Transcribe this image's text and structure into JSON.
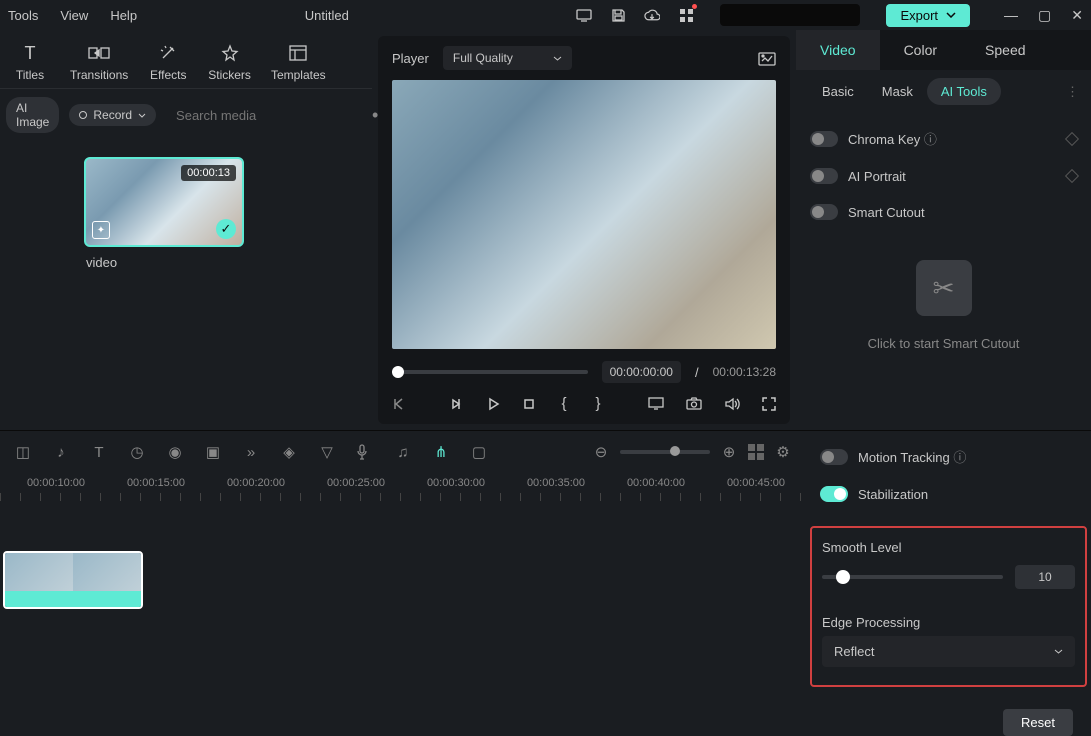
{
  "titlebar": {
    "menus": [
      "Tools",
      "View",
      "Help"
    ],
    "title": "Untitled",
    "export": "Export"
  },
  "toolTabs": [
    {
      "label": "Titles"
    },
    {
      "label": "Transitions"
    },
    {
      "label": "Effects"
    },
    {
      "label": "Stickers"
    },
    {
      "label": "Templates"
    }
  ],
  "filter": {
    "aiImage": "AI Image",
    "record": "Record",
    "searchPlaceholder": "Search media"
  },
  "media": {
    "duration": "00:00:13",
    "name": "video"
  },
  "preview": {
    "playerLabel": "Player",
    "quality": "Full Quality",
    "currentTime": "00:00:00:00",
    "sep": "/",
    "totalTime": "00:00:13:28"
  },
  "propTabs": [
    "Video",
    "Color",
    "Speed"
  ],
  "subTabs": [
    "Basic",
    "Mask",
    "AI Tools"
  ],
  "props": {
    "chroma": "Chroma Key",
    "aiPortrait": "AI Portrait",
    "smartCutout": "Smart Cutout",
    "cutoutHint": "Click to start Smart Cutout",
    "motionTracking": "Motion Tracking",
    "stabilization": "Stabilization",
    "smoothLevel": "Smooth Level",
    "smoothValue": "10",
    "edgeProcessing": "Edge Processing",
    "edgeValue": "Reflect",
    "reset": "Reset"
  },
  "ruler": [
    "00:00:10:00",
    "00:00:15:00",
    "00:00:20:00",
    "00:00:25:00",
    "00:00:30:00",
    "00:00:35:00",
    "00:00:40:00",
    "00:00:45:00"
  ]
}
